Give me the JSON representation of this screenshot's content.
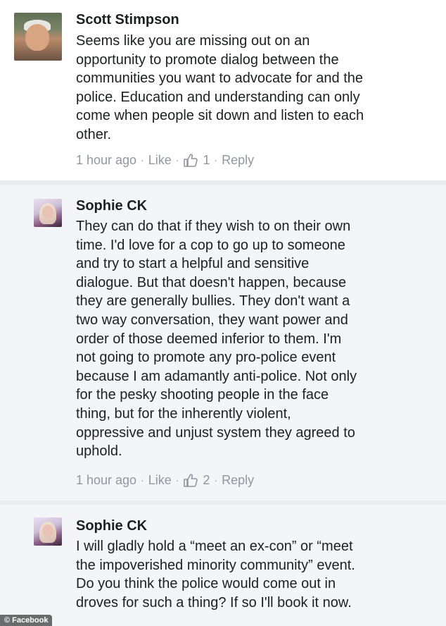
{
  "comments": [
    {
      "author": "Scott Stimpson",
      "text": "Seems like you are missing out on an\nopportunity to promote dialog between the\ncommunities you want to advocate for and the\npolice.  Education and understanding can only\ncome when people sit down and listen to each\nother.",
      "time": "1 hour ago",
      "like_label": "Like",
      "like_count": "1",
      "reply_label": "Reply"
    },
    {
      "author": "Sophie CK",
      "text": "They can do that if they wish to on their own\ntime. I'd love for a cop to go up to someone\nand try to start a helpful and sensitive\ndialogue. But that doesn't happen, because\nthey are generally bullies. They don't want a\ntwo way conversation, they want power and\norder of those deemed inferior to them. I'm\nnot going to promote any pro-police event\nbecause I am adamantly anti-police. Not only\nfor the pesky shooting people in the face\nthing, but for the inherently violent,\noppressive and unjust system they agreed to\nuphold.",
      "time": "1 hour ago",
      "like_label": "Like",
      "like_count": "2",
      "reply_label": "Reply"
    },
    {
      "author": "Sophie CK",
      "text": "I will gladly hold a “meet an ex-con” or “meet\nthe impoverished minority community” event.\nDo you think the police would come out in\ndroves for such a thing? If so I'll book it now."
    }
  ],
  "separator": "·",
  "watermark": {
    "symbol": "©",
    "text": "Facebook"
  },
  "icons": {
    "like_reaction": "thumbs-up-icon",
    "watermark": "copyright-icon"
  },
  "colors": {
    "text": "#1d1f23",
    "meta": "#9097a0",
    "like_icon": "#9097a0"
  }
}
